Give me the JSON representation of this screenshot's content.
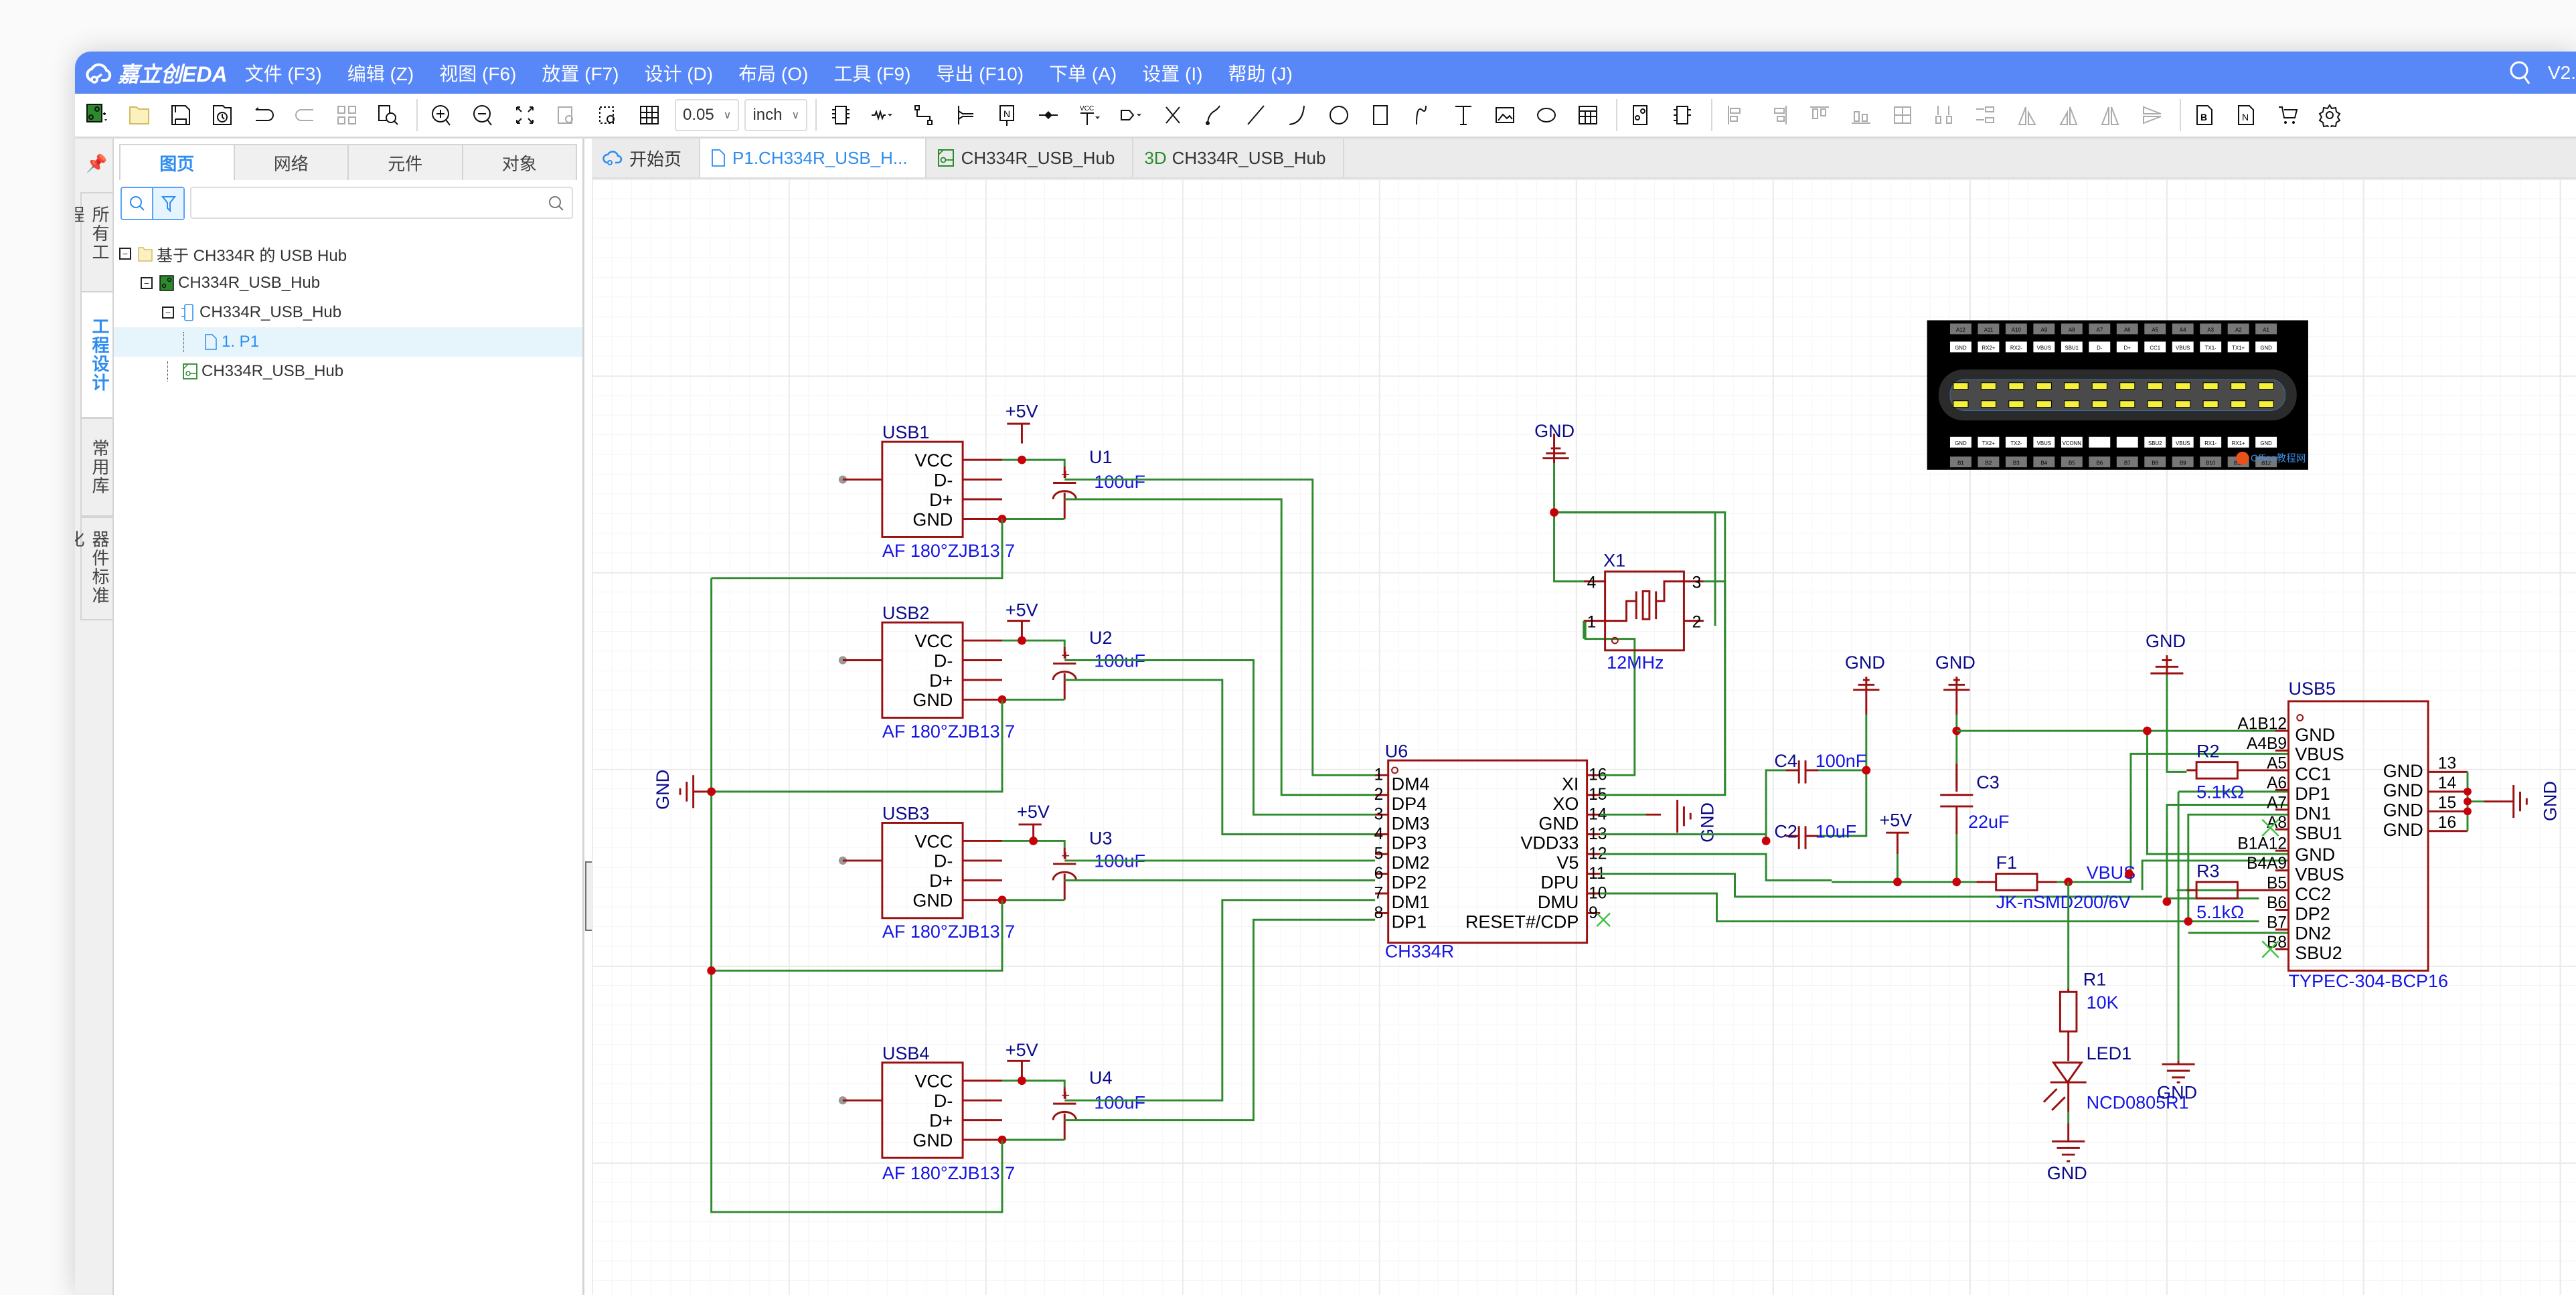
{
  "app": {
    "logo_text": "嘉立创EDA",
    "version": "V2.",
    "menu": [
      "文件 (F3)",
      "编辑 (Z)",
      "视图 (F6)",
      "放置 (F7)",
      "设计 (D)",
      "布局 (O)",
      "工具 (F9)",
      "导出 (F10)",
      "下单 (A)",
      "设置 (I)",
      "帮助 (J)"
    ],
    "brand_color": "#5887f7"
  },
  "toolbar": {
    "grid_value": "0.05",
    "unit_value": "inch",
    "icons": [
      "new-schematic-icon",
      "open-folder-icon",
      "save-icon",
      "save-history-icon",
      "undo-icon",
      "redo-icon",
      "group-icon",
      "find-icon",
      "zoom-in-icon",
      "zoom-out-icon",
      "fit-icon",
      "zoom-selection-icon",
      "zoom-area-icon",
      "grid-icon",
      "component-icon",
      "resistor-icon",
      "wire-icon",
      "bus-icon",
      "netlabel-icon",
      "junction-icon",
      "vcc-icon",
      "netport-icon",
      "no-connect-icon",
      "freehand-icon",
      "line-icon",
      "arc-icon",
      "circle-icon",
      "rectangle-icon",
      "bezier-icon",
      "text-icon",
      "image-icon",
      "ellipse-icon",
      "table-icon",
      "cross-probe-icon",
      "convert-icon",
      "align-left-icon",
      "align-right-icon",
      "align-top-icon",
      "align-bottom-icon",
      "align-center-icon",
      "distribute-h-icon",
      "distribute-v-icon",
      "rotate-left-icon",
      "rotate-right-icon",
      "flip-h-icon",
      "flip-v-icon",
      "bom-icon",
      "netlist-icon",
      "order-icon",
      "settings-icon"
    ]
  },
  "side_tabs": [
    "所有工程",
    "工程设计",
    "常用库",
    "器件标准化"
  ],
  "panel": {
    "tabs": [
      "图页",
      "网络",
      "元件",
      "对象"
    ],
    "search_placeholder": "",
    "tree": [
      {
        "label": "基于 CH334R 的 USB Hub",
        "icon": "folder-icon"
      },
      {
        "label": "CH334R_USB_Hub",
        "icon": "board-icon"
      },
      {
        "label": "CH334R_USB_Hub",
        "icon": "schematic-icon"
      },
      {
        "label": "1. P1",
        "icon": "page-icon",
        "selected": true
      },
      {
        "label": "CH334R_USB_Hub",
        "icon": "pcb-icon"
      }
    ]
  },
  "doc_tabs": [
    {
      "label": "开始页",
      "icon": "cloud-icon"
    },
    {
      "label": "P1.CH334R_USB_H...",
      "icon": "page-icon",
      "active": true
    },
    {
      "label": "CH334R_USB_Hub",
      "icon": "pcb-icon"
    },
    {
      "label": "CH334R_USB_Hub",
      "icon": "3d-icon",
      "prefix": "3D"
    }
  ],
  "schematic": {
    "usb_a": [
      {
        "ref": "USB1",
        "cap": "U1",
        "cap_value": "100uF",
        "value": "AF 180°ZJB13.7",
        "pins": [
          "VCC",
          "D-",
          "D+",
          "GND"
        ],
        "power": "+5V"
      },
      {
        "ref": "USB2",
        "cap": "U2",
        "cap_value": "100uF",
        "value": "AF 180°ZJB13.7",
        "pins": [
          "VCC",
          "D-",
          "D+",
          "GND"
        ],
        "power": "+5V"
      },
      {
        "ref": "USB3",
        "cap": "U3",
        "cap_value": "100uF",
        "value": "AF 180°ZJB13.7",
        "pins": [
          "VCC",
          "D-",
          "D+",
          "GND"
        ],
        "power": "+5V"
      },
      {
        "ref": "USB4",
        "cap": "U4",
        "cap_value": "100uF",
        "value": "AF 180°ZJB13.7",
        "pins": [
          "VCC",
          "D-",
          "D+",
          "GND"
        ],
        "power": "+5V"
      }
    ],
    "hub_ic": {
      "ref": "U6",
      "value": "CH334R",
      "left_pins": [
        {
          "n": "1",
          "name": "DM4"
        },
        {
          "n": "2",
          "name": "DP4"
        },
        {
          "n": "3",
          "name": "DM3"
        },
        {
          "n": "4",
          "name": "DP3"
        },
        {
          "n": "5",
          "name": "DM2"
        },
        {
          "n": "6",
          "name": "DP2"
        },
        {
          "n": "7",
          "name": "DM1"
        },
        {
          "n": "8",
          "name": "DP1"
        }
      ],
      "right_pins": [
        {
          "n": "16",
          "name": "XI"
        },
        {
          "n": "15",
          "name": "XO"
        },
        {
          "n": "14",
          "name": "GND"
        },
        {
          "n": "13",
          "name": "VDD33"
        },
        {
          "n": "12",
          "name": "V5"
        },
        {
          "n": "11",
          "name": "DPU"
        },
        {
          "n": "10",
          "name": "DMU"
        },
        {
          "n": "9",
          "name": "RESET#/CDP"
        }
      ]
    },
    "crystal": {
      "ref": "X1",
      "value": "12MHz",
      "pins": [
        "4",
        "3",
        "1",
        "2"
      ]
    },
    "caps": [
      {
        "ref": "C4",
        "value": "100nF"
      },
      {
        "ref": "C2",
        "value": "10uF"
      },
      {
        "ref": "C3",
        "value": "22uF"
      }
    ],
    "fuse": {
      "ref": "F1",
      "value": "JK-nSMD200/6V"
    },
    "resistors": [
      {
        "ref": "R1",
        "value": "10K"
      },
      {
        "ref": "R2",
        "value": "5.1kΩ"
      },
      {
        "ref": "R3",
        "value": "5.1kΩ"
      }
    ],
    "led": {
      "ref": "LED1",
      "value": "NCD0805R1"
    },
    "typec": {
      "ref": "USB5",
      "value": "TYPEC-304-BCP16",
      "left_pins": [
        {
          "n": "A1B12",
          "name": "GND"
        },
        {
          "n": "A4B9",
          "name": "VBUS"
        },
        {
          "n": "A5",
          "name": "CC1"
        },
        {
          "n": "A6",
          "name": "DP1"
        },
        {
          "n": "A7",
          "name": "DN1"
        },
        {
          "n": "A8",
          "name": "SBU1"
        },
        {
          "n": "B1A12",
          "name": "GND"
        },
        {
          "n": "B4A9",
          "name": "VBUS"
        },
        {
          "n": "B5",
          "name": "CC2"
        },
        {
          "n": "B6",
          "name": "DP2"
        },
        {
          "n": "B7",
          "name": "DN2"
        },
        {
          "n": "B8",
          "name": "SBU2"
        }
      ],
      "right_pins": [
        {
          "n": "13",
          "name": "GND"
        },
        {
          "n": "14",
          "name": "GND"
        },
        {
          "n": "15",
          "name": "GND"
        },
        {
          "n": "16",
          "name": "GND"
        }
      ]
    },
    "net_labels": {
      "gnd": "GND",
      "vcc": "+5V",
      "vbus": "VBUS"
    },
    "wire_color": "#2e8b2e",
    "part_color": "#9b1010",
    "junction_color": "#c8000a"
  },
  "typec_pinout": {
    "top_pins": [
      "A12",
      "A11",
      "A10",
      "A9",
      "A8",
      "A7",
      "A6",
      "A5",
      "A4",
      "A3",
      "A2",
      "A1"
    ],
    "top_names": [
      "GND",
      "RX2+",
      "RX2-",
      "VBUS",
      "SBU1",
      "D-",
      "D+",
      "CC1",
      "VBUS",
      "TX1-",
      "TX1+",
      "GND"
    ],
    "bottom_names": [
      "GND",
      "TX2+",
      "TX2-",
      "VBUS",
      "VCONN",
      "",
      "",
      "SBU2",
      "VBUS",
      "RX1-",
      "RX1+",
      "GND"
    ],
    "bottom_pins": [
      "B1",
      "B2",
      "B3",
      "B4",
      "B5",
      "B6",
      "B7",
      "B8",
      "B9",
      "B10",
      "B11",
      "B12"
    ],
    "watermark": "Office教程网"
  }
}
